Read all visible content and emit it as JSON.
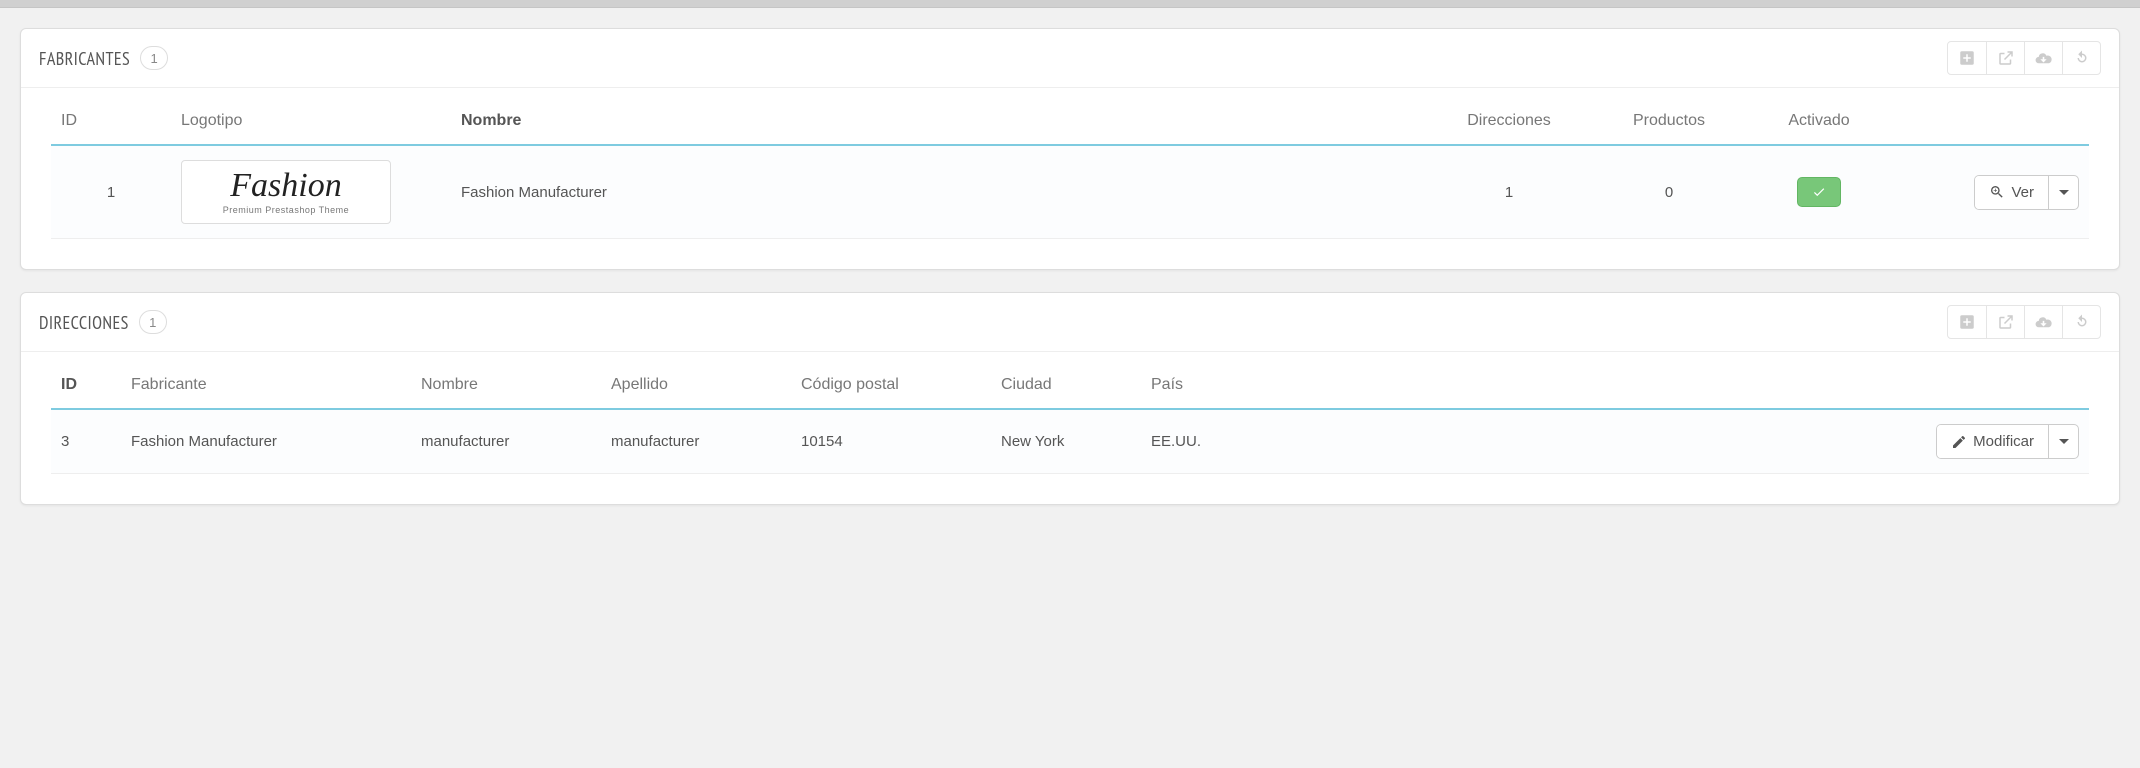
{
  "manufacturers_panel": {
    "title": "FABRICANTES",
    "count": "1",
    "columns": {
      "id": "ID",
      "logo": "Logotipo",
      "name": "Nombre",
      "addresses": "Direcciones",
      "products": "Productos",
      "enabled": "Activado"
    },
    "row": {
      "id": "1",
      "logo_text": "Fashion",
      "logo_subtitle": "Premium Prestashop Theme",
      "name": "Fashion Manufacturer",
      "addresses": "1",
      "products": "0"
    },
    "actions": {
      "view": "Ver"
    }
  },
  "addresses_panel": {
    "title": "DIRECCIONES",
    "count": "1",
    "columns": {
      "id": "ID",
      "manufacturer": "Fabricante",
      "firstname": "Nombre",
      "lastname": "Apellido",
      "postcode": "Código postal",
      "city": "Ciudad",
      "country": "País"
    },
    "row": {
      "id": "3",
      "manufacturer": "Fashion Manufacturer",
      "firstname": "manufacturer",
      "lastname": "manufacturer",
      "postcode": "10154",
      "city": "New York",
      "country": "EE.UU."
    },
    "actions": {
      "edit": "Modificar"
    }
  }
}
